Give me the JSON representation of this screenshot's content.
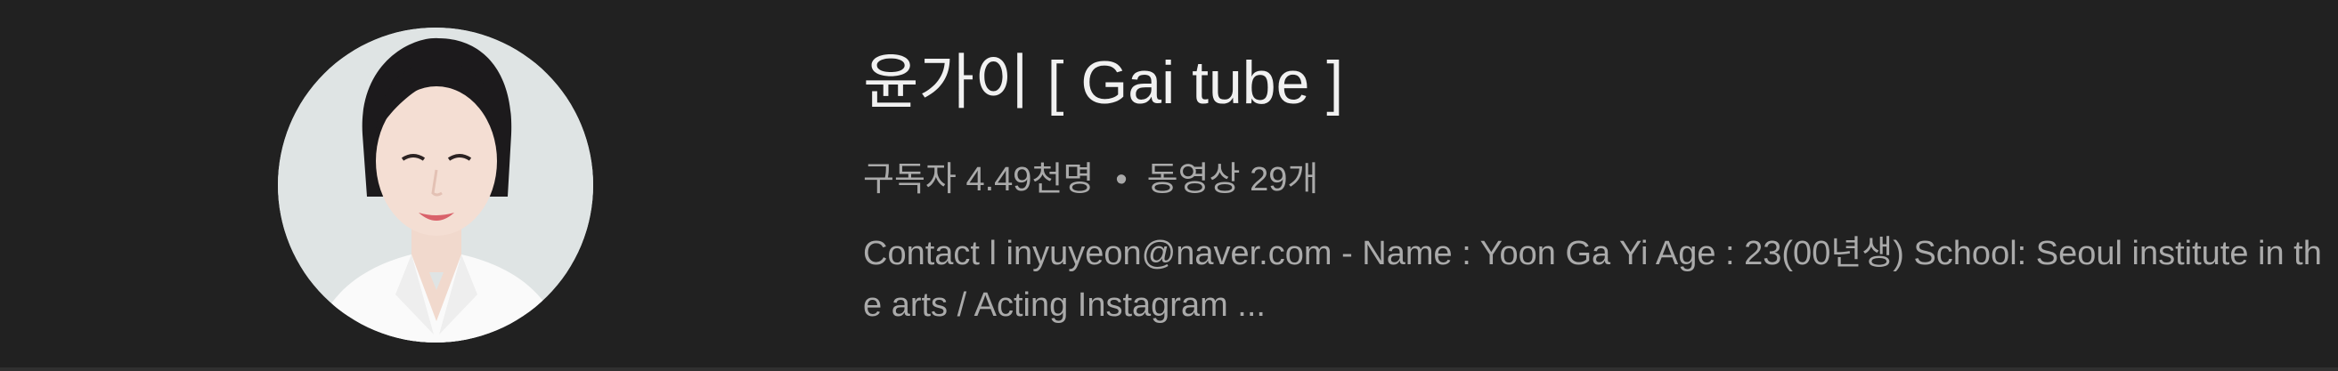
{
  "channel": {
    "title": "윤가이 [ Gai tube ]",
    "subscribers": "구독자 4.49천명",
    "separator": "•",
    "videos": "동영상 29개",
    "description": "Contact l inyuyeon@naver.com - Name : Yoon Ga Yi Age : 23(00년생) School: Seoul institute in the arts / Acting Instagram ...",
    "avatar_icon": "channel-avatar-portrait"
  },
  "colors": {
    "background": "#212121",
    "title": "#f1f1f1",
    "secondary_text": "#aaaaaa"
  }
}
